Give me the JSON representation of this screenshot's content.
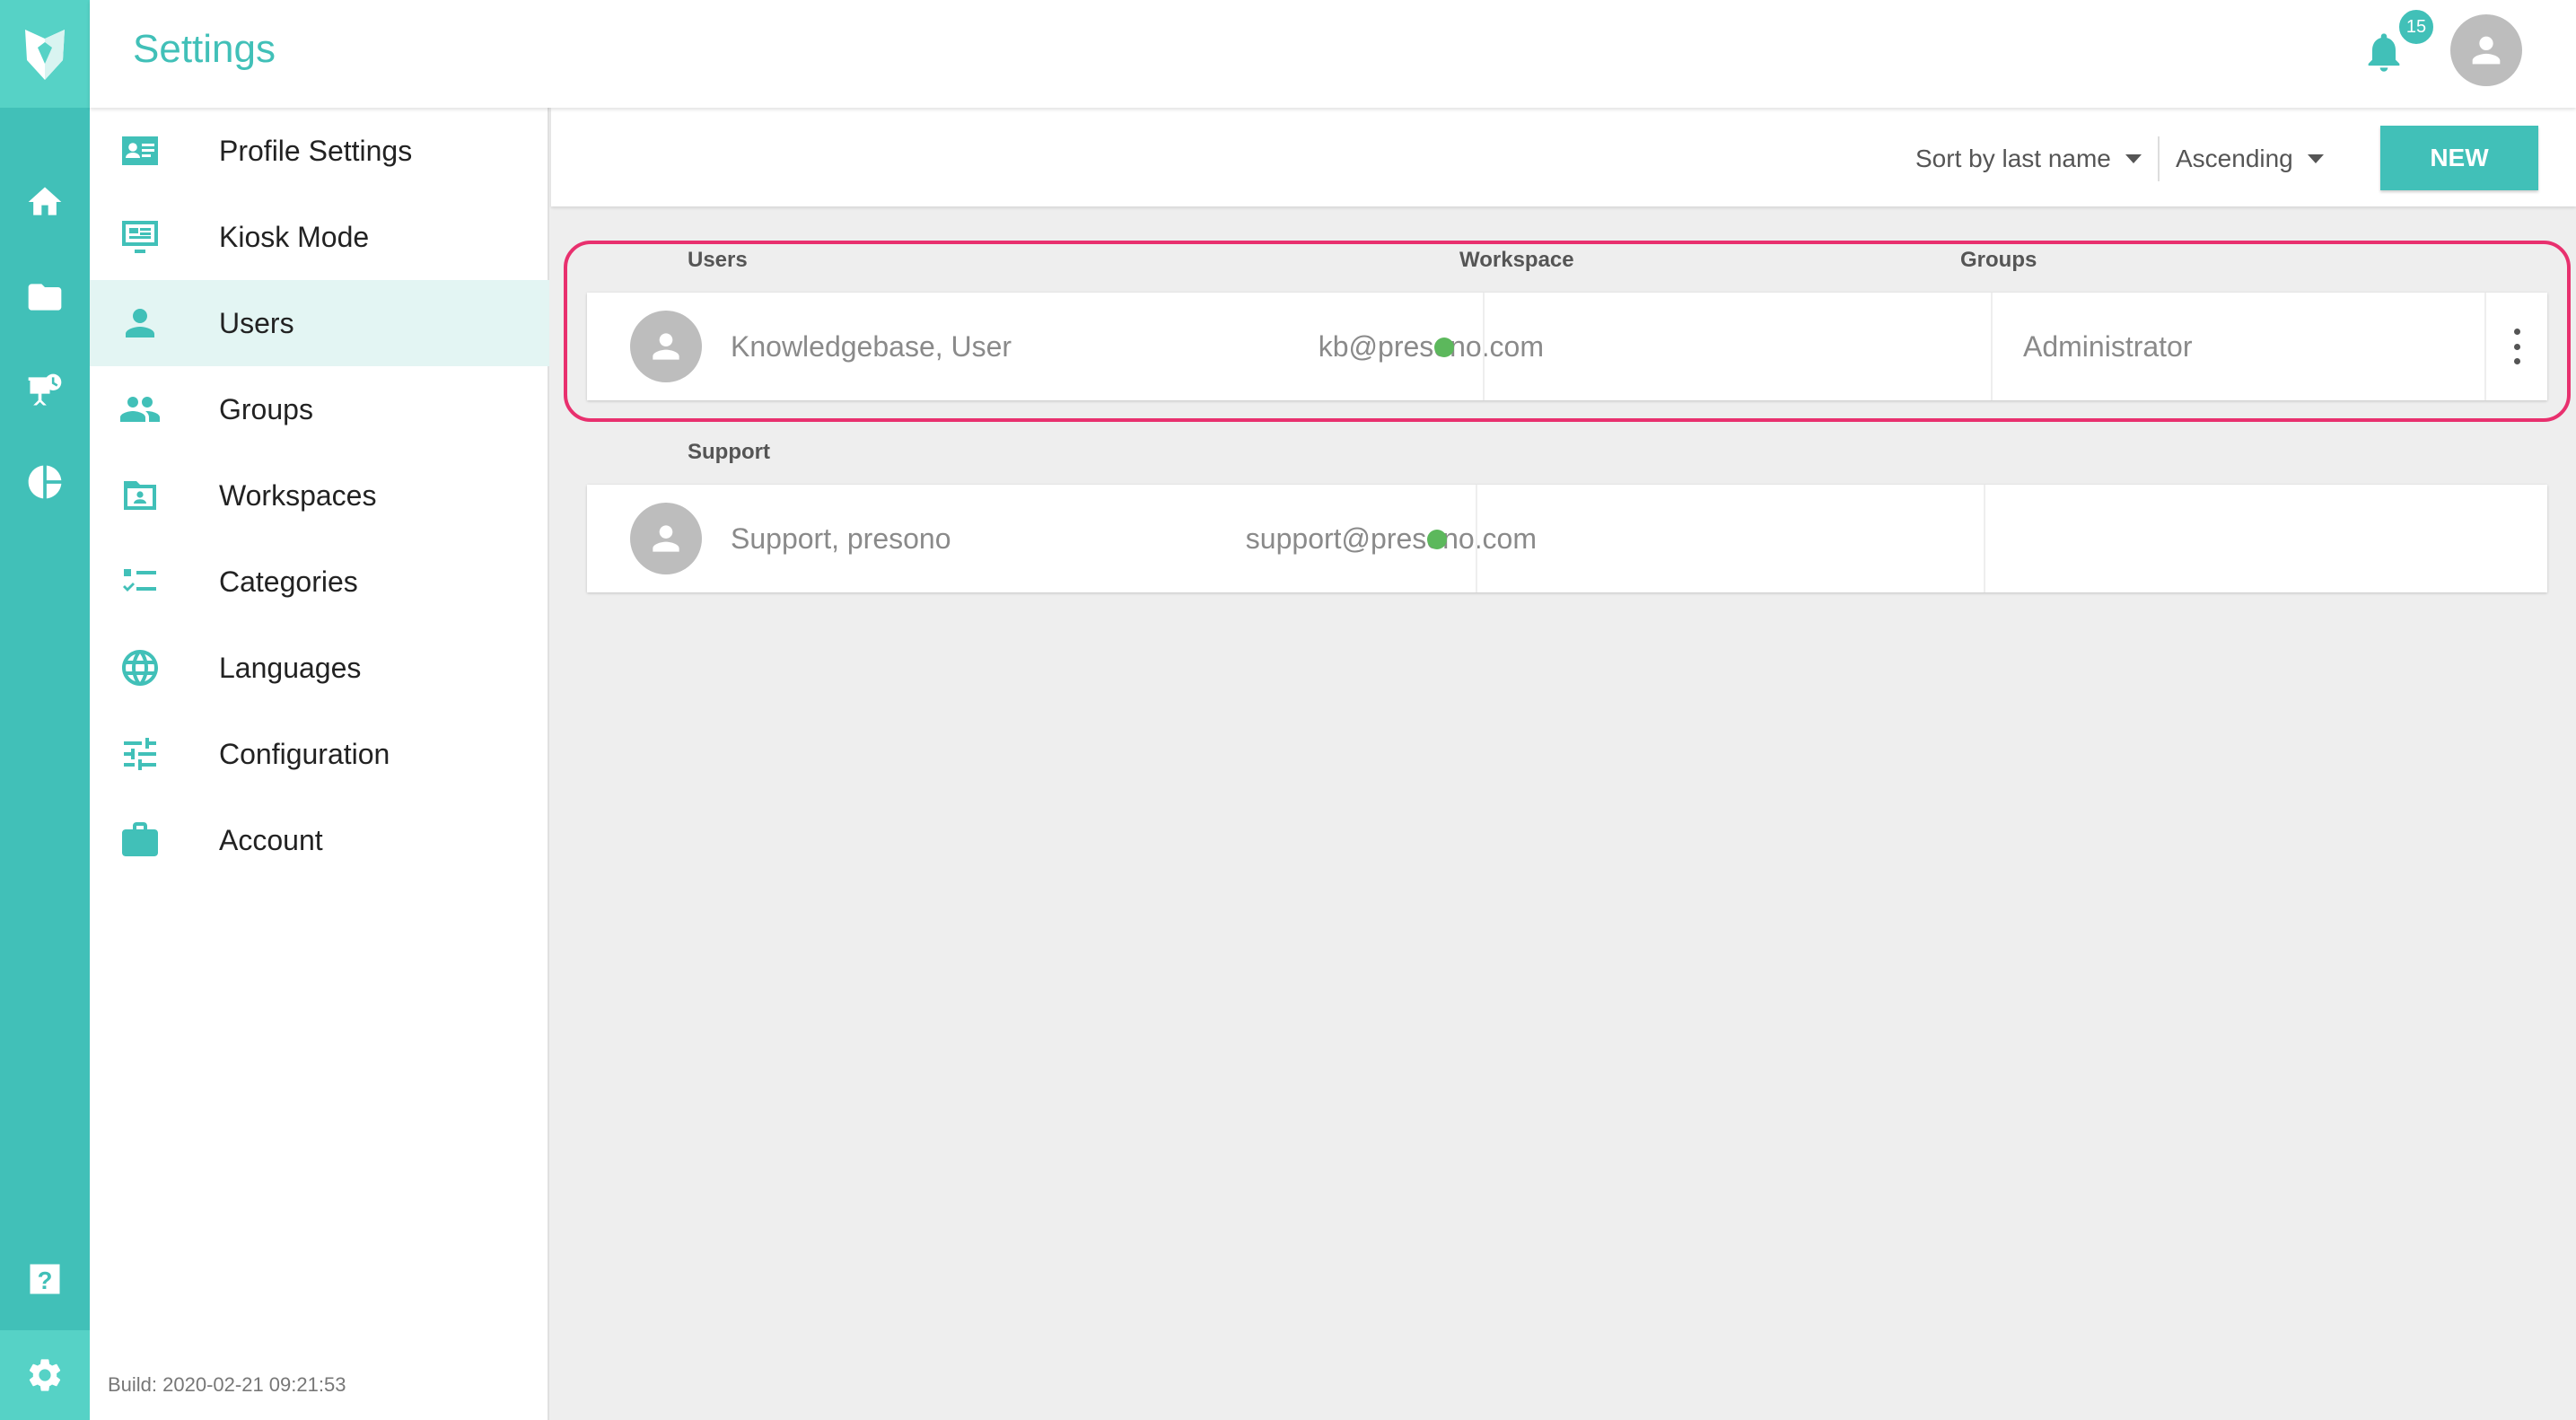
{
  "header": {
    "title": "Settings",
    "notifications_count": "15"
  },
  "rail": {
    "icons": [
      "logo-icon",
      "home-icon",
      "folder-icon",
      "presentation-icon",
      "pie-chart-icon",
      "help-icon",
      "settings-gear-icon"
    ]
  },
  "menu": {
    "items": [
      {
        "label": "Profile Settings",
        "icon": "profile-card-icon"
      },
      {
        "label": "Kiosk Mode",
        "icon": "monitor-icon"
      },
      {
        "label": "Users",
        "icon": "person-icon"
      },
      {
        "label": "Groups",
        "icon": "people-icon"
      },
      {
        "label": "Workspaces",
        "icon": "workspace-folder-icon"
      },
      {
        "label": "Categories",
        "icon": "checklist-icon"
      },
      {
        "label": "Languages",
        "icon": "globe-icon"
      },
      {
        "label": "Configuration",
        "icon": "sliders-icon"
      },
      {
        "label": "Account",
        "icon": "briefcase-icon"
      }
    ],
    "active": "Users",
    "build": "Build: 2020-02-21 09:21:53"
  },
  "toolbar": {
    "sort_label": "Sort by last name",
    "order_label": "Ascending",
    "new_label": "NEW"
  },
  "columns": {
    "users": "Users",
    "workspace": "Workspace",
    "groups": "Groups"
  },
  "sections": [
    {
      "title": "Users",
      "rows": [
        {
          "name": "Knowledgebase, User",
          "email": "kb@presono.com",
          "workspace": "",
          "group": "Administrator",
          "status_color": "#5cb85c"
        }
      ]
    },
    {
      "title": "Support",
      "rows": [
        {
          "name": "Support, presono",
          "email": "support@presono.com",
          "workspace": "",
          "group": "",
          "status_color": "#5cb85c"
        }
      ]
    }
  ],
  "colors": {
    "accent": "#41c0b8",
    "highlight": "#e8306e"
  }
}
